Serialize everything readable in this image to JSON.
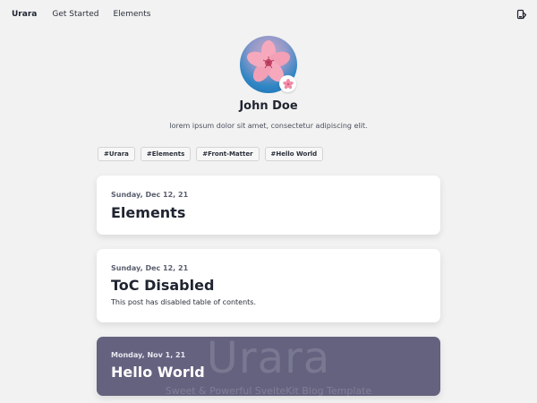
{
  "navbar": {
    "brand": "Urara",
    "links": [
      {
        "label": "Get Started"
      },
      {
        "label": "Elements"
      }
    ],
    "theme_icon": "theme-toggle-icon"
  },
  "profile": {
    "name": "John Doe",
    "bio": "lorem ipsum dolor sit amet, consectetur adipiscing elit.",
    "avatar_icon": "cherry-blossom-avatar",
    "badge_icon": "cherry-blossom-icon"
  },
  "tags": [
    {
      "label": "#Urara"
    },
    {
      "label": "#Elements"
    },
    {
      "label": "#Front-Matter"
    },
    {
      "label": "#Hello World"
    }
  ],
  "posts": [
    {
      "date": "Sunday, Dec 12, 21",
      "title": "Elements",
      "summary": ""
    },
    {
      "date": "Sunday, Dec 12, 21",
      "title": "ToC Disabled",
      "summary": "This post has disabled table of contents."
    },
    {
      "date": "Monday, Nov 1, 21",
      "title": "Hello World",
      "summary": "",
      "cover_text": "Urara",
      "cover_subtext": "Sweet & Powerful SvelteKit Blog Template"
    }
  ],
  "colors": {
    "background": "#f2f2f2",
    "card": "#ffffff",
    "cover_card": "#64627f",
    "text": "#1f2430"
  }
}
